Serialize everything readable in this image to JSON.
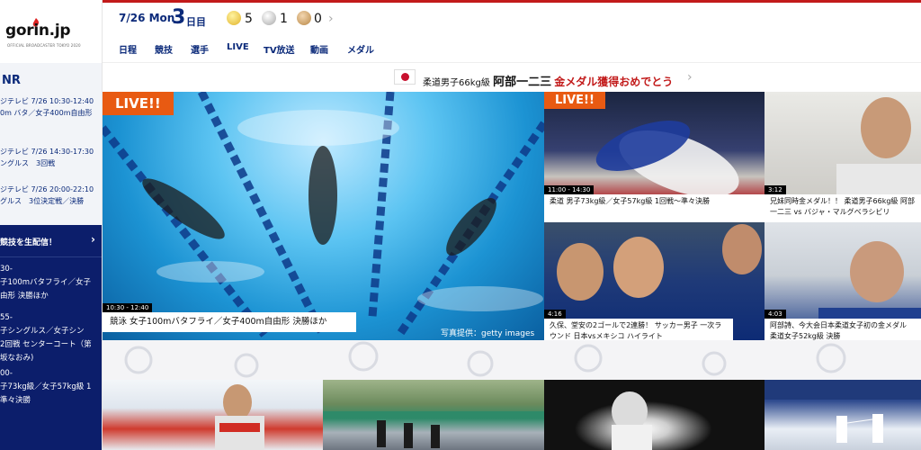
{
  "brand": {
    "logo": "gorin.jp",
    "logo_sub": "OFFICIAL BROADCASTER TOKYO 2020"
  },
  "header": {
    "date": "7/26 Mon",
    "day_number": "3",
    "day_label": "日目",
    "medals": {
      "gold": "5",
      "silver": "1",
      "bronze": "0"
    }
  },
  "nav": {
    "items": [
      "日程",
      "競技",
      "選手",
      "LIVE",
      "TV放送",
      "動画",
      "メダル"
    ]
  },
  "notice": {
    "prefix": "柔道男子66kg級",
    "name": "阿部一二三",
    "congrats": "金メダル獲得おめでとう"
  },
  "sidebar": {
    "tv_title": "NR",
    "tv_items": [
      {
        "time": "ジテレビ 7/26 10:30-12:40",
        "program": "0m バタ／女子400m自由形"
      },
      {
        "time": "ジテレビ 7/26 14:30-17:30",
        "program": "ングルス　3回戦"
      },
      {
        "time": "ジテレビ 7/26 20:00-22:10",
        "program": "グルス　3位決定戦／決勝"
      }
    ],
    "live_title": "競技を生配信！",
    "live_items": [
      {
        "lines": [
          "30-",
          "子100mバタフライ／女子",
          "由形 決勝ほか"
        ]
      },
      {
        "lines": [
          "55-",
          "子シングルス／女子シン",
          "2回戦 センターコート（第",
          "坂なおみ)"
        ]
      },
      {
        "lines": [
          "00-",
          "子73kg級／女子57kg級 1",
          "準々決勝"
        ]
      }
    ]
  },
  "tiles": {
    "main": {
      "badge": "LIVE!!",
      "time": "10:30 - 12:40",
      "caption": "競泳 女子100mバタフライ／女子400m自由形 決勝ほか",
      "credit": "写真提供：getty images"
    },
    "judo_live": {
      "badge": "LIVE!!",
      "time": "11:00 - 14:30",
      "caption": "柔道 男子73kg級／女子57kg級 1回戦〜準々決勝"
    },
    "judo_gold": {
      "time": "3:12",
      "caption": "兄妹同時金メダル！！ 柔道男子66kg級 阿部一二三 vs バジャ・マルグベラシビリ"
    },
    "soccer": {
      "time": "4:16",
      "caption": "久保、堂安の2ゴールで2連勝！ サッカー男子 一次ラウンド 日本vsメキシコ ハイライト"
    },
    "judo_women": {
      "time": "4:03",
      "caption": "阿部詩、今大会日本柔道女子初の金メダル 柔道女子52kg級 決勝"
    }
  }
}
